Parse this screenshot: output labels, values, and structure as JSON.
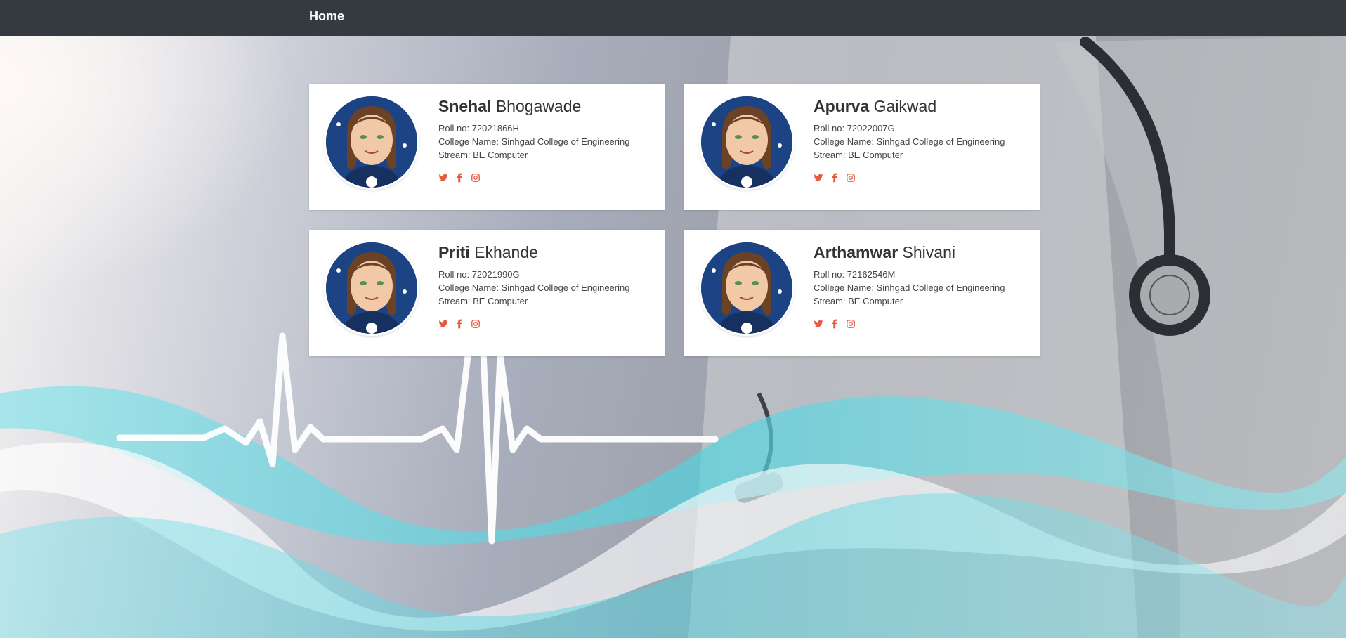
{
  "nav": {
    "brand": "Home"
  },
  "students": [
    {
      "first_name": "Snehal",
      "last_name": "Bhogawade",
      "roll": "Roll no: 72021866H",
      "college": "College Name: Sinhgad College of Engineering",
      "stream": "Stream: BE Computer"
    },
    {
      "first_name": "Apurva",
      "last_name": "Gaikwad",
      "roll": "Roll no: 72022007G",
      "college": "College Name: Sinhgad College of Engineering",
      "stream": "Stream: BE Computer"
    },
    {
      "first_name": "Priti",
      "last_name": "Ekhande",
      "roll": "Roll no: 72021990G",
      "college": "College Name: Sinhgad College of Engineering",
      "stream": "Stream: BE Computer"
    },
    {
      "first_name": "Arthamwar",
      "last_name": "Shivani",
      "roll": "Roll no: 72162546M",
      "college": "College Name: Sinhgad College of Engineering",
      "stream": "Stream: BE Computer"
    }
  ],
  "social_icons": [
    "twitter-icon",
    "facebook-icon",
    "instagram-icon"
  ],
  "colors": {
    "navbar": "#343a40",
    "social_accent": "#e9573f",
    "card": "#ffffff"
  }
}
